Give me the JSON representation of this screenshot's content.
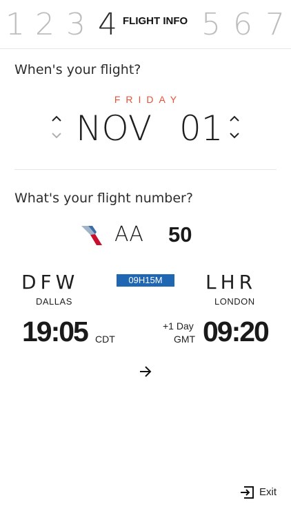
{
  "steps": {
    "items": [
      "1",
      "2",
      "3",
      "4",
      "5",
      "6",
      "7"
    ],
    "current_title": "FLIGHT INFO"
  },
  "date_section": {
    "question": "When's your flight?",
    "weekday": "FRIDAY",
    "month": "NOV",
    "day": "01"
  },
  "flight_section": {
    "question": "What's your flight number?",
    "airline_code": "AA",
    "flight_number": "50",
    "airline_logo_icon": "american-airlines-logo"
  },
  "route": {
    "origin_code": "DFW",
    "origin_city": "DALLAS",
    "destination_code": "LHR",
    "destination_city": "LONDON",
    "duration": "09H15M",
    "departure_time": "19:05",
    "departure_tz": "CDT",
    "arrival_time": "09:20",
    "arrival_tz": "GMT",
    "arrival_day_offset": "+1 Day"
  },
  "footer": {
    "next_icon": "arrow-right-icon",
    "exit_label": "Exit",
    "exit_icon": "exit-icon"
  },
  "colors": {
    "accent_red": "#e8503a",
    "duration_blue": "#1f66b3",
    "muted_step": "#bdbdbd"
  }
}
